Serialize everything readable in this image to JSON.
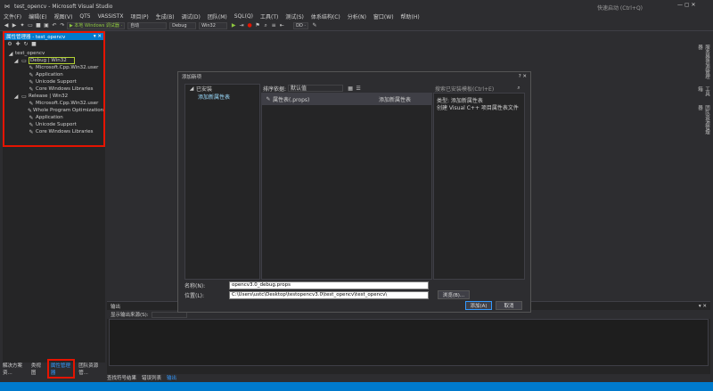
{
  "window": {
    "title": "test_opencv - Microsoft Visual Studio",
    "quick_launch": "快速启动 (Ctrl+Q)"
  },
  "menu": [
    "文件(F)",
    "编辑(E)",
    "视图(V)",
    "QT5",
    "VASSISTX",
    "项目(P)",
    "生成(B)",
    "调试(D)",
    "团队(M)",
    "SQL(Q)",
    "工具(T)",
    "测试(S)",
    "体系结构(C)",
    "分析(N)",
    "窗口(W)",
    "帮助(H)"
  ],
  "toolbar": {
    "debugger": "▶ 本地 Windows 调试器 ·",
    "auto": "自动",
    "config": "Debug",
    "platform": "Win32",
    "dd": "DD ·"
  },
  "property_manager": {
    "title": "属性管理器 - test_opencv",
    "pin": "▾ ✕",
    "project": "test_opencv",
    "debug_node": "Debug | Win32",
    "debug_items": [
      "Microsoft.Cpp.Win32.user",
      "Application",
      "Unicode Support",
      "Core Windows Libraries"
    ],
    "release_node": "Release | Win32",
    "release_items": [
      "Microsoft.Cpp.Win32.user",
      "Whole Program Optimization",
      "Application",
      "Unicode Support",
      "Core Windows Libraries"
    ]
  },
  "bottom_tabs": [
    "解决方案资...",
    "类视图",
    "属性管理器",
    "团队资源管..."
  ],
  "right_rail": [
    "服务器资源管理器",
    "工具箱",
    "团队资源管理器"
  ],
  "output": {
    "title": "输出",
    "source_label": "显示输出来源(S):",
    "tabs": [
      "查找符号结果",
      "错误列表",
      "输出"
    ]
  },
  "dialog": {
    "title": "添加新项",
    "left_header": "已安装",
    "left_item": "添加新属性表",
    "sort_label": "排序依据:",
    "sort_value": "默认值",
    "template_name": "属性表(.props)",
    "template_type": "添加新属性表",
    "search_placeholder": "搜索已安装模板(Ctrl+E)",
    "type_line": "类型: 添加新属性表",
    "desc_line": "创建 Visual C++ 项目属性表文件",
    "name_label": "名称(N):",
    "name_value": "opencv3.0_debug.props",
    "location_label": "位置(L):",
    "location_value": "C:\\Users\\ustc\\Desktop\\testopencv3.0\\test_opencv\\test_opencv\\",
    "browse": "浏览(B)...",
    "add": "添加(A)",
    "cancel": "取消"
  },
  "colors": {
    "accent": "#007acc",
    "highlight_box": "#e51400",
    "selected_outline": "#b4d334"
  }
}
